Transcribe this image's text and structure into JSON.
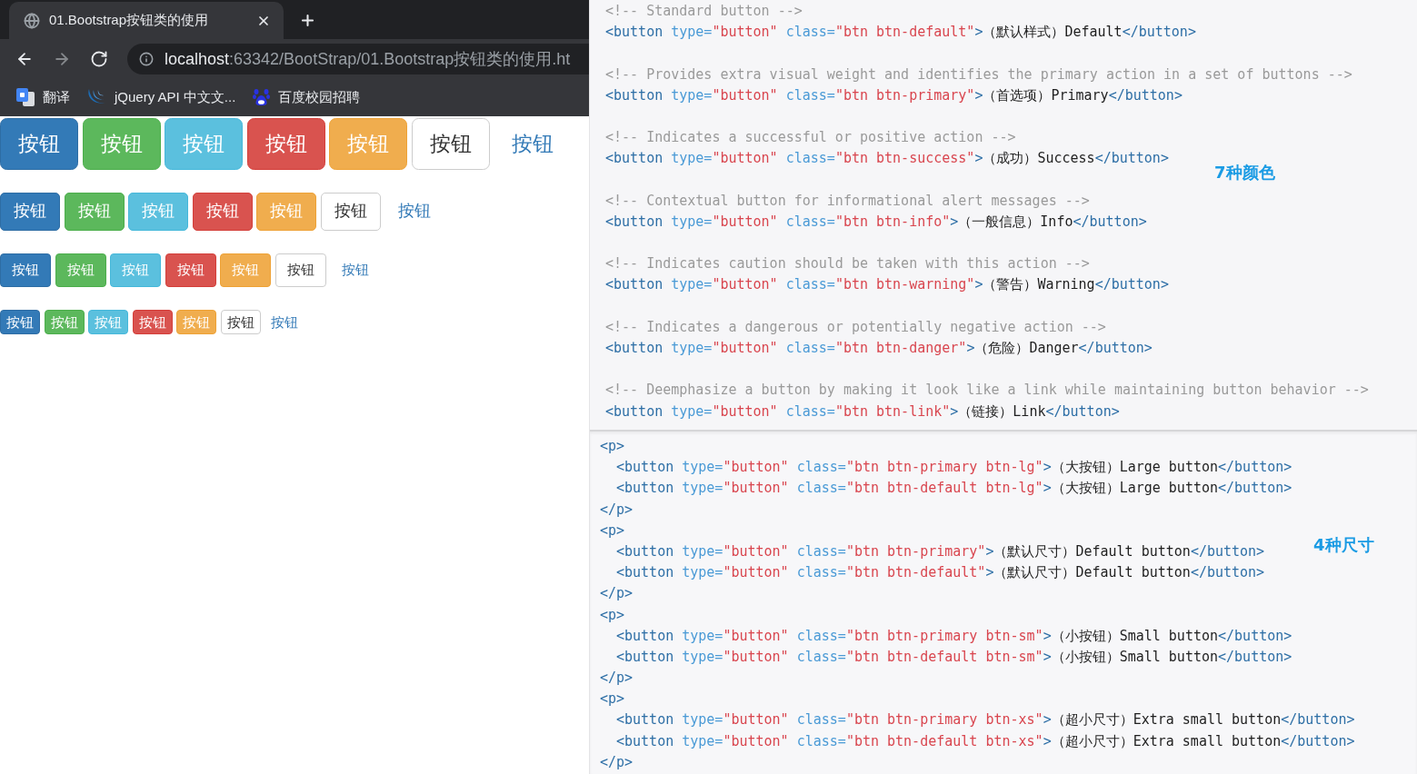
{
  "browser": {
    "tab": {
      "title": "01.Bootstrap按钮类的使用",
      "selected": true
    },
    "nav_buttons": [
      {
        "kind": "back",
        "disabled": false
      },
      {
        "kind": "forward",
        "disabled": true
      },
      {
        "kind": "reload",
        "disabled": false
      }
    ],
    "address": {
      "host": "localhost",
      "path": ":63342/BootStrap/01.Bootstrap按钮类的使用.ht"
    },
    "bookmarks": [
      {
        "kind": "translate",
        "label": "翻译"
      },
      {
        "kind": "jquery",
        "label": "jQuery API 中文文..."
      },
      {
        "kind": "baidu",
        "label": "百度校园招聘"
      }
    ]
  },
  "page": {
    "button_rows": [
      {
        "kind": "large",
        "buttons": [
          {
            "kind": "primary",
            "label": "按钮"
          },
          {
            "kind": "success",
            "label": "按钮"
          },
          {
            "kind": "info",
            "label": "按钮"
          },
          {
            "kind": "danger",
            "label": "按钮"
          },
          {
            "kind": "warning",
            "label": "按钮"
          },
          {
            "kind": "default",
            "label": "按钮"
          },
          {
            "kind": "link",
            "label": "按钮"
          }
        ]
      },
      {
        "kind": "medium",
        "buttons": [
          {
            "kind": "primary",
            "label": "按钮"
          },
          {
            "kind": "success",
            "label": "按钮"
          },
          {
            "kind": "info",
            "label": "按钮"
          },
          {
            "kind": "danger",
            "label": "按钮"
          },
          {
            "kind": "warning",
            "label": "按钮"
          },
          {
            "kind": "default",
            "label": "按钮"
          },
          {
            "kind": "link",
            "label": "按钮"
          }
        ]
      },
      {
        "kind": "small",
        "buttons": [
          {
            "kind": "primary",
            "label": "按钮"
          },
          {
            "kind": "success",
            "label": "按钮"
          },
          {
            "kind": "info",
            "label": "按钮"
          },
          {
            "kind": "danger",
            "label": "按钮"
          },
          {
            "kind": "warning",
            "label": "按钮"
          },
          {
            "kind": "default",
            "label": "按钮"
          },
          {
            "kind": "link",
            "label": "按钮"
          }
        ]
      },
      {
        "kind": "tiny",
        "buttons": [
          {
            "kind": "primary",
            "label": "按钮"
          },
          {
            "kind": "success",
            "label": "按钮"
          },
          {
            "kind": "info",
            "label": "按钮"
          },
          {
            "kind": "danger",
            "label": "按钮"
          },
          {
            "kind": "warning",
            "label": "按钮"
          },
          {
            "kind": "default",
            "label": "按钮"
          },
          {
            "kind": "link",
            "label": "按钮"
          }
        ]
      }
    ]
  },
  "color_examples": {
    "note": "7种颜色",
    "snippets": [
      {
        "lines": [
          {
            "tokens": [
              {
                "kind": "comment",
                "text": "<!-- Standard button -->"
              }
            ]
          },
          {
            "tokens": [
              {
                "kind": "tag",
                "text": "<button"
              },
              {
                "kind": "attr",
                "text": " type="
              },
              {
                "kind": "string",
                "text": "\"button\""
              },
              {
                "kind": "attr",
                "text": " class="
              },
              {
                "kind": "string",
                "text": "\"btn btn-default\""
              },
              {
                "kind": "tag",
                "text": ">"
              },
              {
                "kind": "text",
                "text": "（默认样式）Default"
              },
              {
                "kind": "tag",
                "text": "</button>"
              }
            ]
          }
        ]
      },
      {
        "lines": [
          {
            "tokens": [
              {
                "kind": "comment",
                "text": "<!-- Provides extra visual weight and identifies the primary action in a set of buttons -->"
              }
            ]
          },
          {
            "tokens": [
              {
                "kind": "tag",
                "text": "<button"
              },
              {
                "kind": "attr",
                "text": " type="
              },
              {
                "kind": "string",
                "text": "\"button\""
              },
              {
                "kind": "attr",
                "text": " class="
              },
              {
                "kind": "string",
                "text": "\"btn btn-primary\""
              },
              {
                "kind": "tag",
                "text": ">"
              },
              {
                "kind": "text",
                "text": "（首选项）Primary"
              },
              {
                "kind": "tag",
                "text": "</button>"
              }
            ]
          }
        ]
      },
      {
        "lines": [
          {
            "tokens": [
              {
                "kind": "comment",
                "text": "<!-- Indicates a successful or positive action -->"
              }
            ]
          },
          {
            "tokens": [
              {
                "kind": "tag",
                "text": "<button"
              },
              {
                "kind": "attr",
                "text": " type="
              },
              {
                "kind": "string",
                "text": "\"button\""
              },
              {
                "kind": "attr",
                "text": " class="
              },
              {
                "kind": "string",
                "text": "\"btn btn-success\""
              },
              {
                "kind": "tag",
                "text": ">"
              },
              {
                "kind": "text",
                "text": "（成功）Success"
              },
              {
                "kind": "tag",
                "text": "</button>"
              }
            ]
          }
        ]
      },
      {
        "lines": [
          {
            "tokens": [
              {
                "kind": "comment",
                "text": "<!-- Contextual button for informational alert messages -->"
              }
            ]
          },
          {
            "tokens": [
              {
                "kind": "tag",
                "text": "<button"
              },
              {
                "kind": "attr",
                "text": " type="
              },
              {
                "kind": "string",
                "text": "\"button\""
              },
              {
                "kind": "attr",
                "text": " class="
              },
              {
                "kind": "string",
                "text": "\"btn btn-info\""
              },
              {
                "kind": "tag",
                "text": ">"
              },
              {
                "kind": "text",
                "text": "（一般信息）Info"
              },
              {
                "kind": "tag",
                "text": "</button>"
              }
            ]
          }
        ]
      },
      {
        "lines": [
          {
            "tokens": [
              {
                "kind": "comment",
                "text": "<!-- Indicates caution should be taken with this action -->"
              }
            ]
          },
          {
            "tokens": [
              {
                "kind": "tag",
                "text": "<button"
              },
              {
                "kind": "attr",
                "text": " type="
              },
              {
                "kind": "string",
                "text": "\"button\""
              },
              {
                "kind": "attr",
                "text": " class="
              },
              {
                "kind": "string",
                "text": "\"btn btn-warning\""
              },
              {
                "kind": "tag",
                "text": ">"
              },
              {
                "kind": "text",
                "text": "（警告）Warning"
              },
              {
                "kind": "tag",
                "text": "</button>"
              }
            ]
          }
        ]
      },
      {
        "lines": [
          {
            "tokens": [
              {
                "kind": "comment",
                "text": "<!-- Indicates a dangerous or potentially negative action -->"
              }
            ]
          },
          {
            "tokens": [
              {
                "kind": "tag",
                "text": "<button"
              },
              {
                "kind": "attr",
                "text": " type="
              },
              {
                "kind": "string",
                "text": "\"button\""
              },
              {
                "kind": "attr",
                "text": " class="
              },
              {
                "kind": "string",
                "text": "\"btn btn-danger\""
              },
              {
                "kind": "tag",
                "text": ">"
              },
              {
                "kind": "text",
                "text": "（危险）Danger"
              },
              {
                "kind": "tag",
                "text": "</button>"
              }
            ]
          }
        ]
      },
      {
        "lines": [
          {
            "tokens": [
              {
                "kind": "comment",
                "text": "<!-- Deemphasize a button by making it look like a link while maintaining button behavior -->"
              }
            ]
          },
          {
            "tokens": [
              {
                "kind": "tag",
                "text": "<button"
              },
              {
                "kind": "attr",
                "text": " type="
              },
              {
                "kind": "string",
                "text": "\"button\""
              },
              {
                "kind": "attr",
                "text": " class="
              },
              {
                "kind": "string",
                "text": "\"btn btn-link\""
              },
              {
                "kind": "tag",
                "text": ">"
              },
              {
                "kind": "text",
                "text": "（链接）Link"
              },
              {
                "kind": "tag",
                "text": "</button>"
              }
            ]
          }
        ]
      }
    ]
  },
  "size_examples": {
    "note": "4种尺寸",
    "lines": [
      {
        "tokens": [
          {
            "kind": "tag",
            "text": "<p>"
          }
        ],
        "children": [
          {
            "tokens": [
              {
                "kind": "tag",
                "text": "<button"
              },
              {
                "kind": "attr",
                "text": " type="
              },
              {
                "kind": "string",
                "text": "\"button\""
              },
              {
                "kind": "attr",
                "text": " class="
              },
              {
                "kind": "string",
                "text": "\"btn btn-primary btn-lg\""
              },
              {
                "kind": "tag",
                "text": ">"
              },
              {
                "kind": "text",
                "text": "（大按钮）Large button"
              },
              {
                "kind": "tag",
                "text": "</button>"
              }
            ]
          },
          {
            "tokens": [
              {
                "kind": "tag",
                "text": "<button"
              },
              {
                "kind": "attr",
                "text": " type="
              },
              {
                "kind": "string",
                "text": "\"button\""
              },
              {
                "kind": "attr",
                "text": " class="
              },
              {
                "kind": "string",
                "text": "\"btn btn-default btn-lg\""
              },
              {
                "kind": "tag",
                "text": ">"
              },
              {
                "kind": "text",
                "text": "（大按钮）Large button"
              },
              {
                "kind": "tag",
                "text": "</button>"
              }
            ]
          }
        ]
      },
      {
        "tokens": [
          {
            "kind": "tag",
            "text": "</p>"
          }
        ]
      },
      {
        "tokens": [
          {
            "kind": "tag",
            "text": "<p>"
          }
        ],
        "children": [
          {
            "tokens": [
              {
                "kind": "tag",
                "text": "<button"
              },
              {
                "kind": "attr",
                "text": " type="
              },
              {
                "kind": "string",
                "text": "\"button\""
              },
              {
                "kind": "attr",
                "text": " class="
              },
              {
                "kind": "string",
                "text": "\"btn btn-primary\""
              },
              {
                "kind": "tag",
                "text": ">"
              },
              {
                "kind": "text",
                "text": "（默认尺寸）Default button"
              },
              {
                "kind": "tag",
                "text": "</button>"
              }
            ]
          },
          {
            "tokens": [
              {
                "kind": "tag",
                "text": "<button"
              },
              {
                "kind": "attr",
                "text": " type="
              },
              {
                "kind": "string",
                "text": "\"button\""
              },
              {
                "kind": "attr",
                "text": " class="
              },
              {
                "kind": "string",
                "text": "\"btn btn-default\""
              },
              {
                "kind": "tag",
                "text": ">"
              },
              {
                "kind": "text",
                "text": "（默认尺寸）Default button"
              },
              {
                "kind": "tag",
                "text": "</button>"
              }
            ]
          }
        ]
      },
      {
        "tokens": [
          {
            "kind": "tag",
            "text": "</p>"
          }
        ]
      },
      {
        "tokens": [
          {
            "kind": "tag",
            "text": "<p>"
          }
        ],
        "children": [
          {
            "tokens": [
              {
                "kind": "tag",
                "text": "<button"
              },
              {
                "kind": "attr",
                "text": " type="
              },
              {
                "kind": "string",
                "text": "\"button\""
              },
              {
                "kind": "attr",
                "text": " class="
              },
              {
                "kind": "string",
                "text": "\"btn btn-primary btn-sm\""
              },
              {
                "kind": "tag",
                "text": ">"
              },
              {
                "kind": "text",
                "text": "（小按钮）Small button"
              },
              {
                "kind": "tag",
                "text": "</button>"
              }
            ]
          },
          {
            "tokens": [
              {
                "kind": "tag",
                "text": "<button"
              },
              {
                "kind": "attr",
                "text": " type="
              },
              {
                "kind": "string",
                "text": "\"button\""
              },
              {
                "kind": "attr",
                "text": " class="
              },
              {
                "kind": "string",
                "text": "\"btn btn-default btn-sm\""
              },
              {
                "kind": "tag",
                "text": ">"
              },
              {
                "kind": "text",
                "text": "（小按钮）Small button"
              },
              {
                "kind": "tag",
                "text": "</button>"
              }
            ]
          }
        ]
      },
      {
        "tokens": [
          {
            "kind": "tag",
            "text": "</p>"
          }
        ]
      },
      {
        "tokens": [
          {
            "kind": "tag",
            "text": "<p>"
          }
        ],
        "children": [
          {
            "tokens": [
              {
                "kind": "tag",
                "text": "<button"
              },
              {
                "kind": "attr",
                "text": " type="
              },
              {
                "kind": "string",
                "text": "\"button\""
              },
              {
                "kind": "attr",
                "text": " class="
              },
              {
                "kind": "string",
                "text": "\"btn btn-primary btn-xs\""
              },
              {
                "kind": "tag",
                "text": ">"
              },
              {
                "kind": "text",
                "text": "（超小尺寸）Extra small button"
              },
              {
                "kind": "tag",
                "text": "</button>"
              }
            ]
          },
          {
            "tokens": [
              {
                "kind": "tag",
                "text": "<button"
              },
              {
                "kind": "attr",
                "text": " type="
              },
              {
                "kind": "string",
                "text": "\"button\""
              },
              {
                "kind": "attr",
                "text": " class="
              },
              {
                "kind": "string",
                "text": "\"btn btn-default btn-xs\""
              },
              {
                "kind": "tag",
                "text": ">"
              },
              {
                "kind": "text",
                "text": "（超小尺寸）Extra small button"
              },
              {
                "kind": "tag",
                "text": "</button>"
              }
            ]
          }
        ]
      },
      {
        "tokens": [
          {
            "kind": "tag",
            "text": "</p>"
          }
        ]
      }
    ]
  }
}
